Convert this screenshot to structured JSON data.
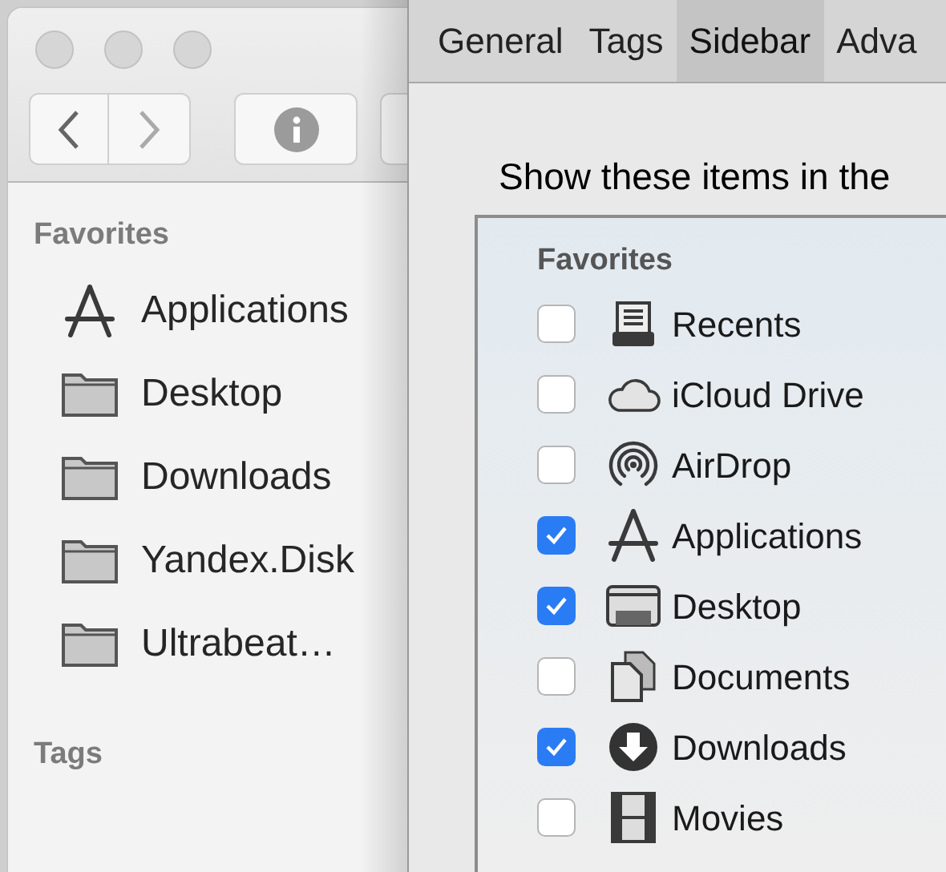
{
  "finder": {
    "sidebar": [
      {
        "title": "Favorites",
        "items": [
          {
            "label": "Applications",
            "kind": "apps"
          },
          {
            "label": "Desktop",
            "kind": "folder"
          },
          {
            "label": "Downloads",
            "kind": "folder"
          },
          {
            "label": "Yandex.Disk",
            "kind": "folder"
          },
          {
            "label": "Ultrabeat…",
            "kind": "folder"
          }
        ]
      },
      {
        "title": "Tags"
      }
    ]
  },
  "preferences": {
    "tabs": [
      {
        "label": "General",
        "selected": false
      },
      {
        "label": "Tags",
        "selected": false
      },
      {
        "label": "Sidebar",
        "selected": true
      },
      {
        "label": "Adva",
        "selected": false
      }
    ],
    "heading": "Show these items in the",
    "list": {
      "title": "Favorites",
      "items": [
        {
          "label": "Recents",
          "checked": false,
          "kind": "recents"
        },
        {
          "label": "iCloud Drive",
          "checked": false,
          "kind": "cloud"
        },
        {
          "label": "AirDrop",
          "checked": false,
          "kind": "airdrop"
        },
        {
          "label": "Applications",
          "checked": true,
          "kind": "apps"
        },
        {
          "label": "Desktop",
          "checked": true,
          "kind": "desktop"
        },
        {
          "label": "Documents",
          "checked": false,
          "kind": "documents"
        },
        {
          "label": "Downloads",
          "checked": true,
          "kind": "downloads"
        },
        {
          "label": "Movies",
          "checked": false,
          "kind": "movies"
        }
      ]
    }
  }
}
